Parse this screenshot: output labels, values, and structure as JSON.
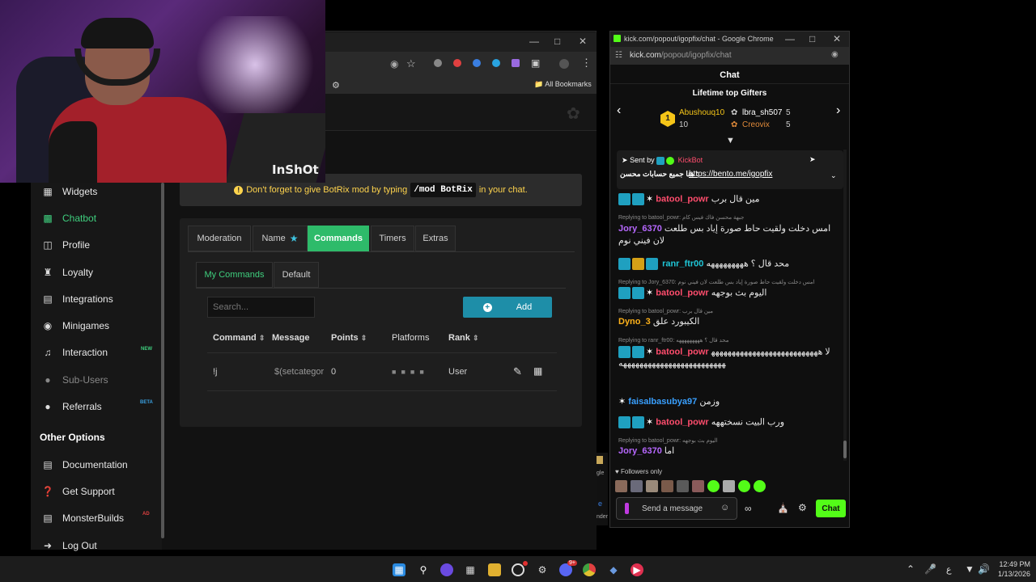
{
  "webcam": {
    "watermark": "InShOt"
  },
  "browser": {
    "bookmarks": "All Bookmarks",
    "sidebar": [
      {
        "label": "Widgets",
        "icon": "grid-icon"
      },
      {
        "label": "Chatbot",
        "icon": "robot-icon"
      },
      {
        "label": "Profile",
        "icon": "id-card-icon"
      },
      {
        "label": "Loyalty",
        "icon": "trophy-icon"
      },
      {
        "label": "Integrations",
        "icon": "list-icon"
      },
      {
        "label": "Minigames",
        "icon": "gamepad-icon"
      },
      {
        "label": "Interaction",
        "icon": "music-icon",
        "badge": "NEW"
      },
      {
        "label": "Sub-Users",
        "icon": "users-icon"
      },
      {
        "label": "Referrals",
        "icon": "people-icon",
        "badge": "BETA"
      }
    ],
    "other_options_title": "Other Options",
    "other_options": [
      {
        "label": "Documentation",
        "icon": "doc-icon"
      },
      {
        "label": "Get Support",
        "icon": "question-icon"
      },
      {
        "label": "MonsterBuilds",
        "icon": "server-icon",
        "badge": "AD"
      },
      {
        "label": "Log Out",
        "icon": "logout-icon"
      }
    ],
    "notice": {
      "pre": "Don't forget to give BotRix mod by typing",
      "code": "/mod BotRix",
      "post": "in your chat."
    },
    "tabs": [
      "Moderation",
      "Name",
      "Commands",
      "Timers",
      "Extras"
    ],
    "subtabs": [
      "My Commands",
      "Default"
    ],
    "search_placeholder": "Search...",
    "add_label": "Add",
    "table": {
      "headers": [
        "Command",
        "Message",
        "Points",
        "Platforms",
        "Rank"
      ],
      "rows": [
        {
          "command": "!j",
          "message": "$(setcategor",
          "points": "0",
          "rank": "User"
        }
      ]
    }
  },
  "chat": {
    "window_title": "kick.com/popout/igopfix/chat - Google Chrome",
    "url_host": "kick.com",
    "url_path": "/popout/igopfix/chat",
    "header": "Chat",
    "gifters_title": "Lifetime top Gifters",
    "gifters": [
      {
        "rank": "1",
        "name": "Abushouq10",
        "count": "10"
      },
      {
        "name": "lbra_sh507",
        "count": "5"
      },
      {
        "name": "Creovix",
        "count": "5"
      }
    ],
    "pinned": {
      "sent_by": "Sent by",
      "bot": "KickBot",
      "text": "هنا جميع حسابات محسن :",
      "link": "https://bento.me/igopfix"
    },
    "messages": [
      {
        "user": "batool_powr",
        "text": "مين قال برب",
        "color": "#ff4d6d"
      },
      {
        "reply": "Replying to batool_powr: جبهة محسن فاك فيس كام"
      },
      {
        "user": "Jory_6370",
        "text": "امس دخلت ولقيت حاط صورة إياد بس طلعت لان فيني نوم",
        "color": "#b768ff"
      },
      {
        "user": "ranr_ftr00",
        "text": "محد قال ؟ هههههههههه",
        "color": "#1fc7d8"
      },
      {
        "reply": "Replying to Jory_6370: امس دخلت ولقيت حاط صورة إياد بس طلعت لان فيني نوم"
      },
      {
        "user": "batool_powr",
        "text": "اليوم بث بوجهه",
        "color": "#ff4d6d"
      },
      {
        "reply": "Replying to batool_powr: مين قال برب"
      },
      {
        "user": "Dyno_3",
        "text": "الكيبورد علق",
        "color": "#ffb21a"
      },
      {
        "reply": "Replying to ranr_ftr00: محد قال ؟ هههههههههه"
      },
      {
        "user": "batool_powr",
        "text": "لا ههههههههههههههههههههههههههههههههههههههههههههههههههههه",
        "color": "#ff4d6d"
      },
      {
        "user": "faisalbasubya97",
        "text": "وزمن",
        "color": "#39a0ff"
      },
      {
        "user": "batool_powr",
        "text": "ورب البيت نسختههه",
        "color": "#ff4d6d"
      },
      {
        "reply": "Replying to batool_powr: اليوم بث بوجهه"
      },
      {
        "user": "Jory_6370",
        "text": "اما",
        "color": "#b768ff"
      }
    ],
    "followers_only": "Followers only",
    "input_placeholder": "Send a message",
    "chat_button": "Chat"
  },
  "behind": {
    "a": "gle",
    "b": "e",
    "c": "nder"
  },
  "taskbar": {
    "time": "12:49 PM",
    "date": "1/13/2026",
    "lang": "ع",
    "badge": "9+"
  }
}
